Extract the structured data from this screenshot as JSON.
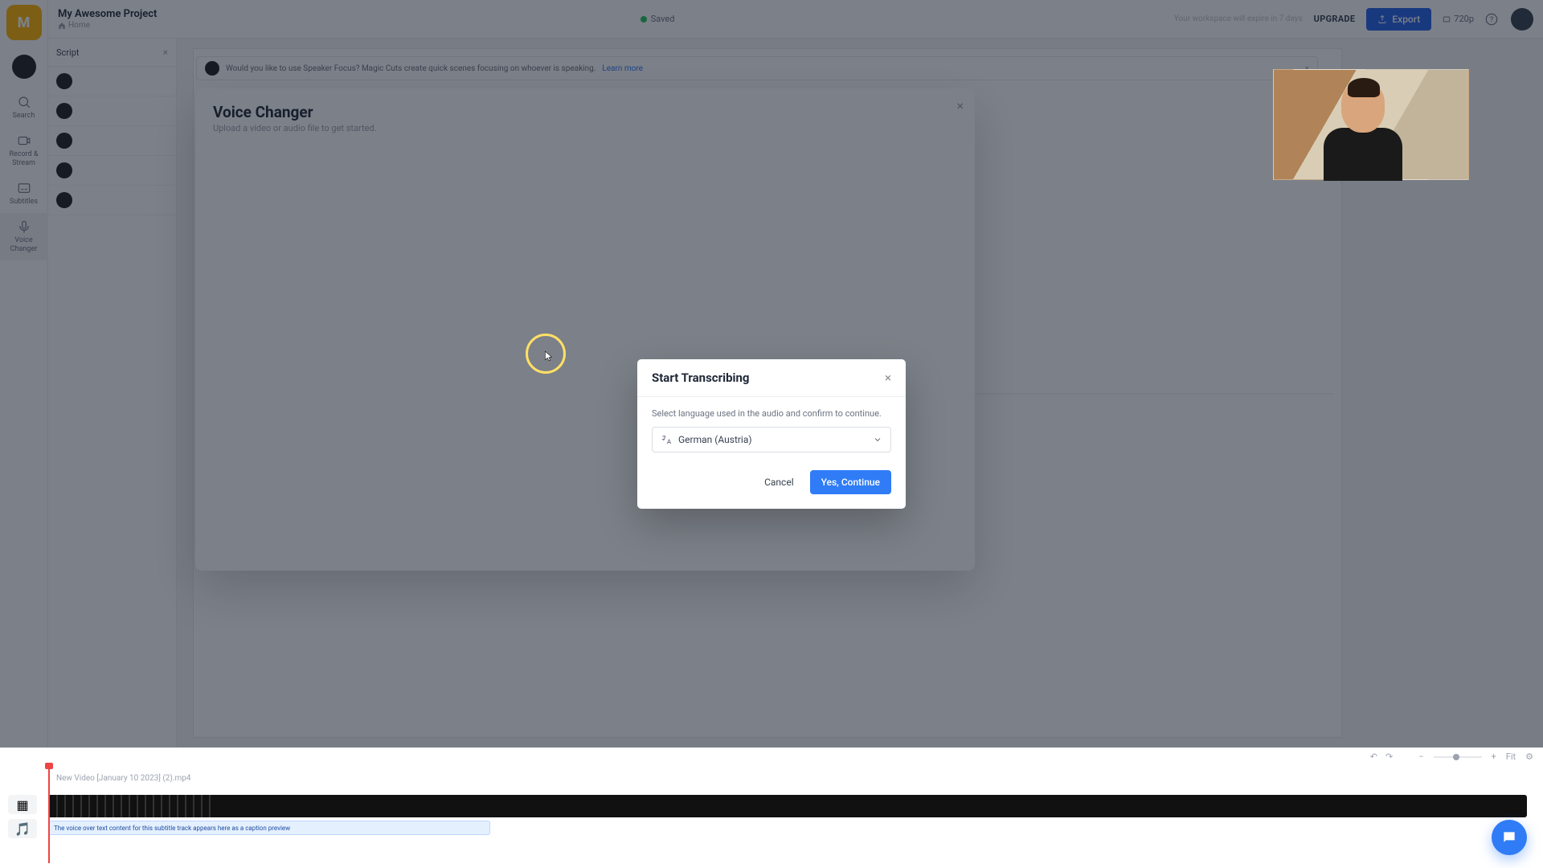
{
  "brand_letter": "M",
  "project": {
    "title": "My Awesome Project",
    "home": "Home"
  },
  "topbar": {
    "saved": "Saved",
    "expiry_hint": "Your workspace will expire in 7 days",
    "upgrade": "UPGRADE",
    "export": "Export",
    "resolution": "720p"
  },
  "sidenav": {
    "search": "Search",
    "record": "Record & Stream",
    "subtitles": "Subtitles",
    "voice_changer": "Voice Changer"
  },
  "script_tab": "Script",
  "alert_text": "Would you like to use Speaker Focus? Magic Cuts create quick scenes focusing on whoever is speaking.",
  "alert_link": "Learn more",
  "voice_changer": {
    "title": "Voice Changer",
    "subtitle": "Upload a video or audio file to get started."
  },
  "modal": {
    "title": "Start Transcribing",
    "desc": "Select language used in the audio and confirm to continue.",
    "selected": "German (Austria)",
    "cancel": "Cancel",
    "confirm": "Yes, Continue"
  },
  "timeline": {
    "clip_label": "New Video [January 10 2023] (2).mp4",
    "subtitle_clip": "The voice over text content for this subtitle track appears here as a caption preview",
    "fit": "Fit"
  }
}
